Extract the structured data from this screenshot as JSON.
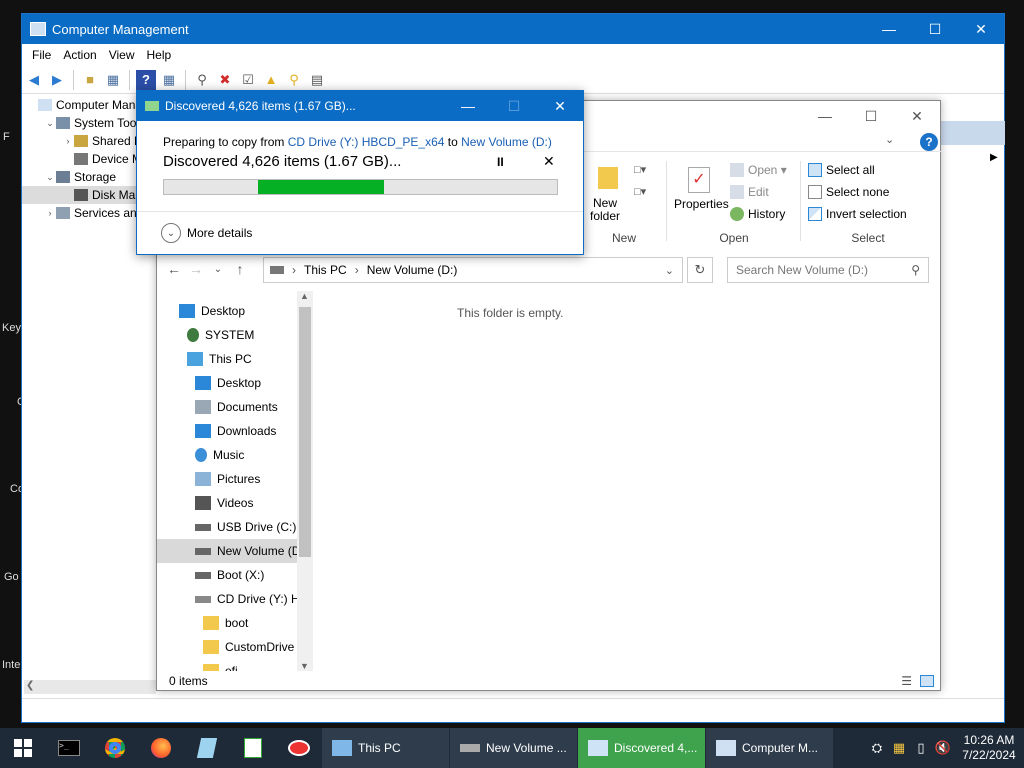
{
  "desktop": {
    "fragments": [
      "F",
      "Key",
      "C",
      "Co",
      "Go",
      "Inte"
    ]
  },
  "computer_management": {
    "title": "Computer Management",
    "menu": [
      "File",
      "Action",
      "View",
      "Help"
    ],
    "tree": [
      {
        "label": "Computer Mana",
        "level": 0,
        "exp": ""
      },
      {
        "label": "System Tools",
        "level": 1,
        "exp": "⌄"
      },
      {
        "label": "Shared Fo",
        "level": 2,
        "exp": "›"
      },
      {
        "label": "Device M",
        "level": 2,
        "exp": ""
      },
      {
        "label": "Storage",
        "level": 1,
        "exp": "⌄"
      },
      {
        "label": "Disk Man",
        "level": 2,
        "exp": ""
      },
      {
        "label": "Services and",
        "level": 1,
        "exp": "›"
      }
    ]
  },
  "explorer": {
    "ribbon": {
      "new_folder": "New\nfolder",
      "new_group": "New",
      "properties": "Properties",
      "open": "Open",
      "edit": "Edit",
      "history": "History",
      "open_group": "Open",
      "select_all": "Select all",
      "select_none": "Select none",
      "invert_selection": "Invert selection",
      "select_group": "Select"
    },
    "breadcrumb": [
      "This PC",
      "New Volume (D:)"
    ],
    "search_placeholder": "Search New Volume (D:)",
    "empty_message": "This folder is empty.",
    "status": "0 items",
    "nav": [
      {
        "label": "Desktop",
        "indent": 0,
        "icon": "desktop-icon",
        "color": "#2b88d8"
      },
      {
        "label": "SYSTEM",
        "indent": 1,
        "icon": "user-icon",
        "color": "#3f7a3f"
      },
      {
        "label": "This PC",
        "indent": 1,
        "icon": "pc-icon",
        "color": "#4aa3df"
      },
      {
        "label": "Desktop",
        "indent": 2,
        "icon": "desktop-icon",
        "color": "#2b88d8"
      },
      {
        "label": "Documents",
        "indent": 2,
        "icon": "documents-icon",
        "color": "#9aa7b4"
      },
      {
        "label": "Downloads",
        "indent": 2,
        "icon": "downloads-icon",
        "color": "#2b88d8"
      },
      {
        "label": "Music",
        "indent": 2,
        "icon": "music-icon",
        "color": "#3b8fd9"
      },
      {
        "label": "Pictures",
        "indent": 2,
        "icon": "pictures-icon",
        "color": "#8bb3d8"
      },
      {
        "label": "Videos",
        "indent": 2,
        "icon": "videos-icon",
        "color": "#555"
      },
      {
        "label": "USB Drive (C:)",
        "indent": 2,
        "icon": "drive-icon",
        "color": "#666"
      },
      {
        "label": "New Volume (D",
        "indent": 2,
        "icon": "drive-icon",
        "color": "#666",
        "selected": true
      },
      {
        "label": "Boot (X:)",
        "indent": 2,
        "icon": "drive-icon",
        "color": "#666"
      },
      {
        "label": "CD Drive (Y:) H",
        "indent": 2,
        "icon": "cd-drive-icon",
        "color": "#888"
      },
      {
        "label": "boot",
        "indent": 3,
        "icon": "folder-icon",
        "color": "#f2c94c"
      },
      {
        "label": "CustomDrive",
        "indent": 3,
        "icon": "folder-icon",
        "color": "#f2c94c"
      },
      {
        "label": "efi",
        "indent": 3,
        "icon": "folder-icon",
        "color": "#f2c94c"
      }
    ]
  },
  "copy_dialog": {
    "title": "Discovered 4,626 items (1.67 GB)...",
    "prep_prefix": "Preparing to copy from ",
    "source": "CD Drive (Y:) HBCD_PE_x64",
    "to": " to ",
    "destination": "New Volume (D:)",
    "headline": "Discovered 4,626 items (1.67 GB)...",
    "pause": "II",
    "cancel": "✕",
    "more_details": "More details",
    "progress": {
      "start": 0.24,
      "end": 0.56
    },
    "progress_color": "#06b025"
  },
  "taskbar": {
    "apps": [
      {
        "label": "This PC",
        "active": false
      },
      {
        "label": "New Volume ...",
        "active": false
      },
      {
        "label": "Discovered 4,...",
        "active": true
      },
      {
        "label": "Computer M...",
        "active": false
      }
    ],
    "time": "10:26 AM",
    "date": "7/22/2024"
  }
}
